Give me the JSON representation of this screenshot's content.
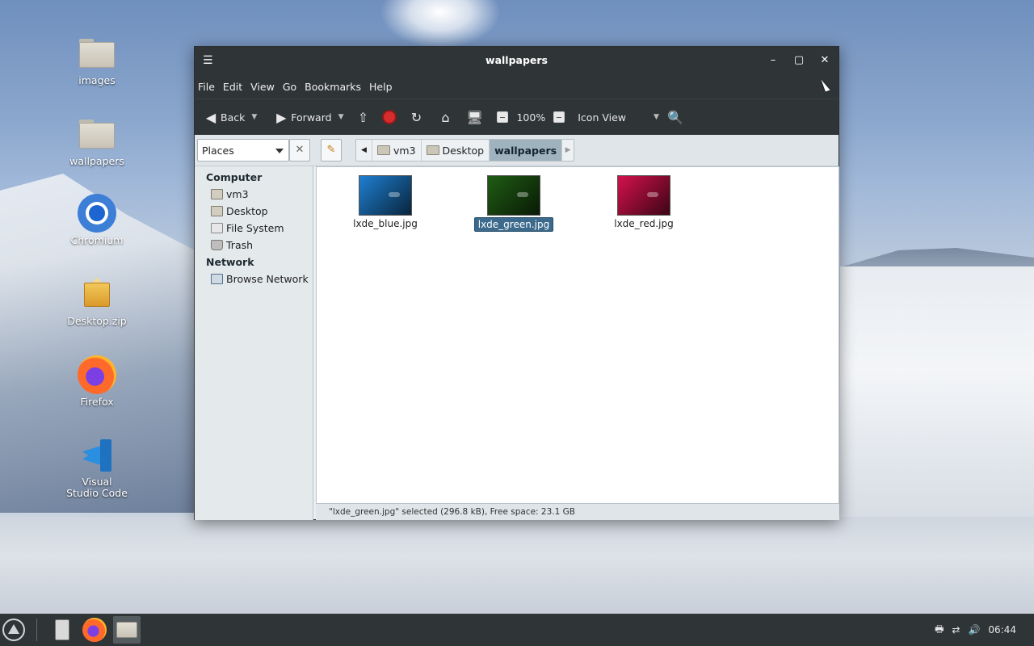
{
  "desktop": {
    "icons": [
      {
        "label": "images"
      },
      {
        "label": "wallpapers"
      },
      {
        "label": "Chromium"
      },
      {
        "label": "Desktop.zip"
      },
      {
        "label": "Firefox"
      },
      {
        "label": "Visual Studio Code"
      }
    ]
  },
  "window": {
    "title": "wallpapers",
    "controls": {
      "minimize": "–",
      "maximize": "▢",
      "close": "✕"
    },
    "menu": [
      "File",
      "Edit",
      "View",
      "Go",
      "Bookmarks",
      "Help"
    ],
    "toolbar": {
      "back": "Back",
      "forward": "Forward",
      "zoom": "100%",
      "view_mode": "Icon View"
    },
    "places": {
      "selected": "Places"
    },
    "breadcrumbs": [
      "vm3",
      "Desktop",
      "wallpapers"
    ],
    "sidebar": {
      "computer_heading": "Computer",
      "computer_items": [
        "vm3",
        "Desktop",
        "File System",
        "Trash"
      ],
      "network_heading": "Network",
      "network_items": [
        "Browse Network"
      ]
    },
    "files": [
      {
        "name": "lxde_blue.jpg",
        "color": "#1f7fd1",
        "selected": false
      },
      {
        "name": "lxde_green.jpg",
        "color": "#1f5c14",
        "selected": true
      },
      {
        "name": "lxde_red.jpg",
        "color": "#d3124d",
        "selected": false
      }
    ],
    "status": "\"lxde_green.jpg\" selected (296.8 kB), Free space: 23.1 GB"
  },
  "taskbar": {
    "clock": "06:44"
  }
}
